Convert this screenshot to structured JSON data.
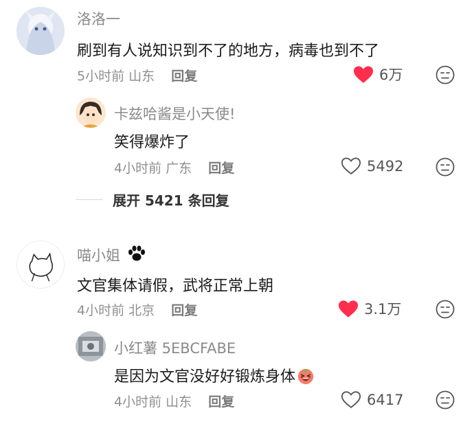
{
  "comments": [
    {
      "username": "洛洛一",
      "text": "刷到有人说知识到不了的地方，病毒也到不了",
      "time": "5小时前",
      "location": "山东",
      "reply_label": "回复",
      "likes": "6万",
      "liked": true,
      "replies": [
        {
          "username": "卡兹哈酱是小天使!",
          "text": "笑得爆炸了",
          "time": "4小时前",
          "location": "广东",
          "reply_label": "回复",
          "likes": "5492",
          "liked": false
        }
      ],
      "expand_label": "展开 5421 条回复"
    },
    {
      "username": "喵小姐",
      "text": "文官集体请假，武将正常上朝",
      "time": "4小时前",
      "location": "北京",
      "reply_label": "回复",
      "likes": "3.1万",
      "liked": true,
      "replies": [
        {
          "username": "小红薯 5EBCFABE",
          "text": "是因为文官没好好锻炼身体",
          "time": "4小时前",
          "location": "山东",
          "reply_label": "回复",
          "likes": "6417",
          "liked": false
        }
      ]
    }
  ],
  "colors": {
    "like_active": "#ff2e4d",
    "muted_text": "#8a8a8a"
  },
  "icons": {
    "like": "heart-icon",
    "dislike": "meh-face-icon",
    "paw": "paw-icon",
    "emoji": "laughing-face-emoji-icon"
  }
}
